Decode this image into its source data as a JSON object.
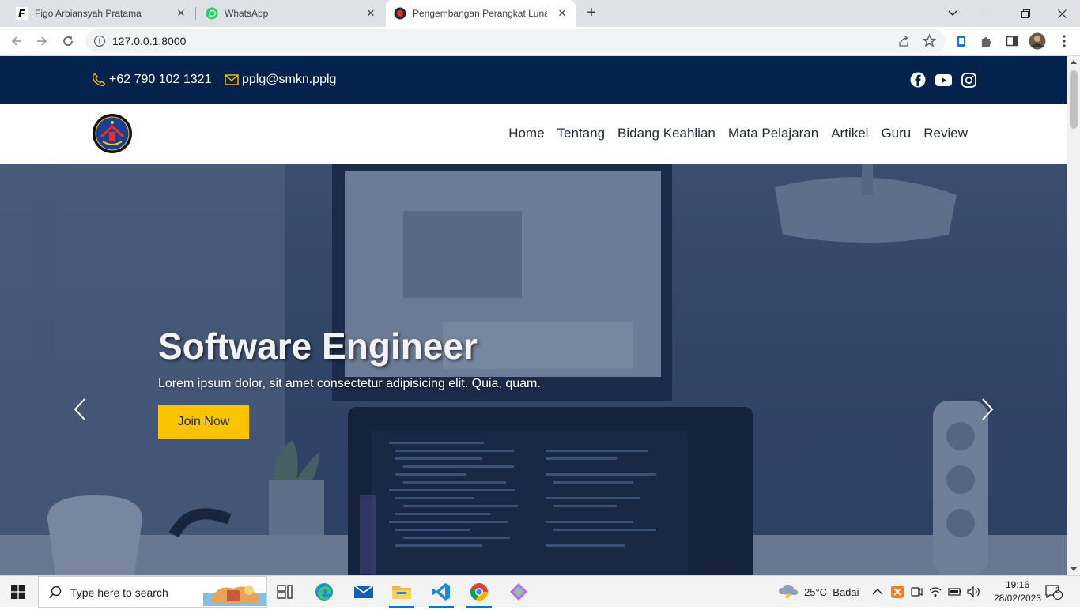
{
  "browser": {
    "tabs": [
      {
        "title": "Figo Arbiansyah Pratama",
        "icon": "f-logo-icon",
        "active": false
      },
      {
        "title": "WhatsApp",
        "icon": "whatsapp-icon",
        "active": false
      },
      {
        "title": "Pengembangan Perangkat Lunak",
        "icon": "school-logo-icon",
        "active": true
      }
    ],
    "url": "127.0.0.1:8000"
  },
  "topbar": {
    "phone": "+62 790 102 1321",
    "email": "pplg@smkn.pplg",
    "social": [
      "facebook-icon",
      "youtube-icon",
      "instagram-icon"
    ]
  },
  "nav": {
    "items": [
      "Home",
      "Tentang",
      "Bidang Keahlian",
      "Mata Pelajaran",
      "Artikel",
      "Guru",
      "Review"
    ]
  },
  "hero": {
    "title": "Software Engineer",
    "subtitle": "Lorem ipsum dolor, sit amet consectetur adipisicing elit. Quia, quam.",
    "button": "Join Now"
  },
  "taskbar": {
    "search_placeholder": "Type here to search",
    "weather": "25°C  Badai",
    "time": "19:16",
    "date": "28/02/2023",
    "notifications": "2"
  },
  "colors": {
    "topbar_bg": "#03224c",
    "accent_yellow": "#fac401",
    "nav_text": "#1d2b3a"
  }
}
